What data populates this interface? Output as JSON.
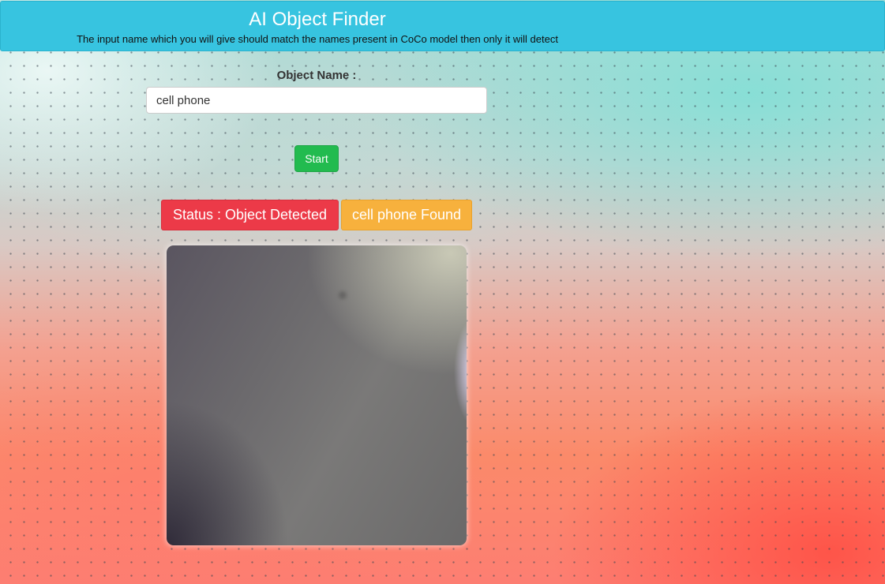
{
  "header": {
    "title": "AI Object Finder",
    "subtitle": "The input name which you will give should match the names present in CoCo model then only it will detect"
  },
  "form": {
    "object_label": "Object Name :",
    "object_value": "cell phone",
    "start_label": "Start"
  },
  "status": {
    "status_text": "Status : Object Detected",
    "found_text": "cell phone Found"
  },
  "colors": {
    "header": "#37c4e0",
    "start_button": "#22bb4f",
    "status_badge": "#ec3a48",
    "found_badge": "#f7b13d"
  }
}
